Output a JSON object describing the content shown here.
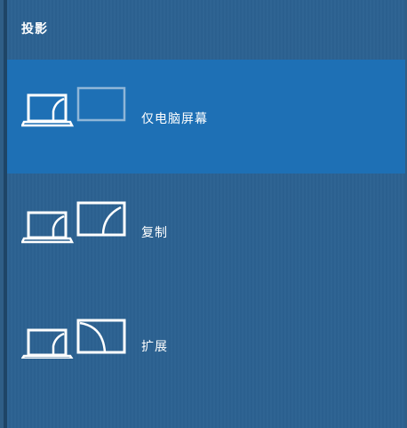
{
  "panel": {
    "title": "投影"
  },
  "options": [
    {
      "label": "仅电脑屏幕",
      "icon": "pc-screen-only-icon",
      "selected": true
    },
    {
      "label": "复制",
      "icon": "duplicate-icon",
      "selected": false
    },
    {
      "label": "扩展",
      "icon": "extend-icon",
      "selected": false
    }
  ],
  "colors": {
    "background": "#2c6291",
    "selected": "#1e70b5",
    "text": "#ffffff"
  }
}
